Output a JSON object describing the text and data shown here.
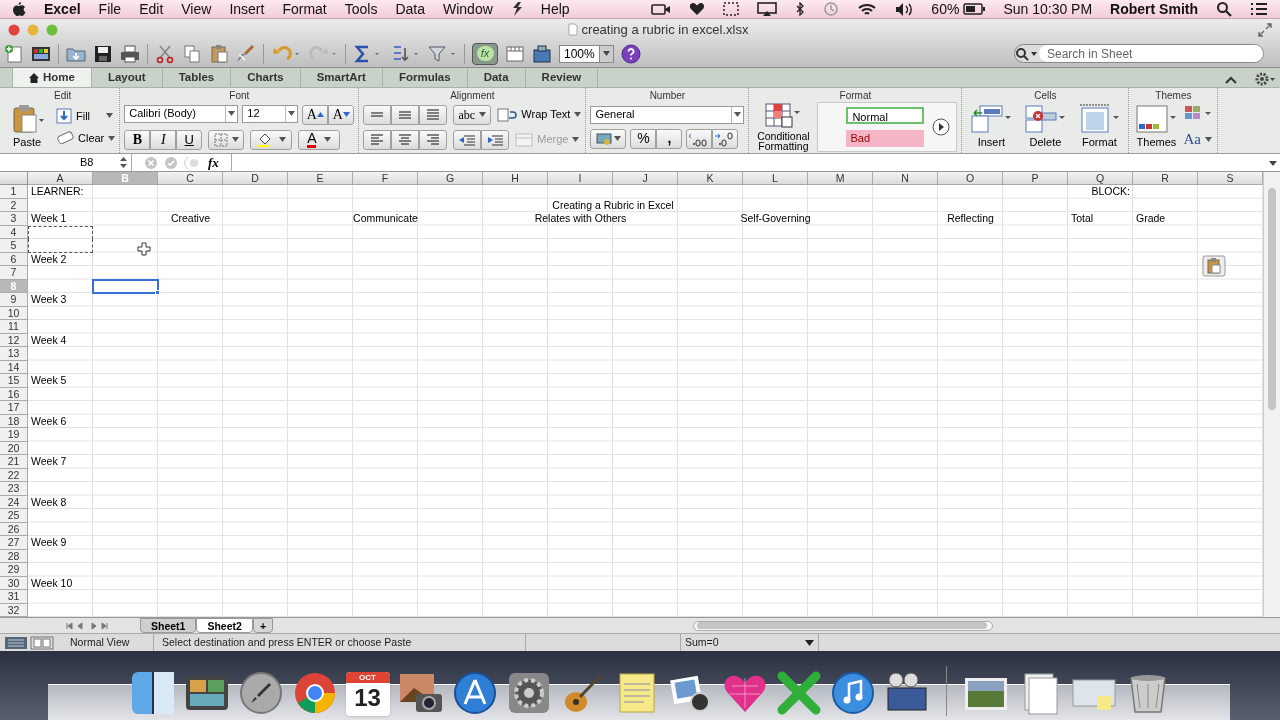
{
  "menu_bar": {
    "app": "Excel",
    "items": [
      "File",
      "Edit",
      "View",
      "Insert",
      "Format",
      "Tools",
      "Data",
      "Window",
      "Help"
    ],
    "battery": "60%",
    "clock": "Sun 10:30 PM",
    "user": "Robert Smith"
  },
  "window": {
    "title": "creating a rubric in excel.xlsx"
  },
  "toolbar": {
    "formula_builder": "fx",
    "zoom": "100%",
    "search": {
      "placeholder": "Search in Sheet"
    }
  },
  "ribbon_tabs": [
    {
      "label": "Home",
      "selected": true
    },
    {
      "label": "Layout",
      "selected": false
    },
    {
      "label": "Tables",
      "selected": false
    },
    {
      "label": "Charts",
      "selected": false
    },
    {
      "label": "SmartArt",
      "selected": false
    },
    {
      "label": "Formulas",
      "selected": false
    },
    {
      "label": "Data",
      "selected": false
    },
    {
      "label": "Review",
      "selected": false
    }
  ],
  "ribbon": {
    "edit": {
      "title": "Edit",
      "paste": "Paste",
      "fill": "Fill",
      "clear": "Clear"
    },
    "font": {
      "title": "Font",
      "family": "Calibri (Body)",
      "size": "12",
      "bold": "B",
      "italic": "I",
      "underline": "U",
      "grow": "A",
      "shrink": "A",
      "font_color_letter": "A"
    },
    "alignment": {
      "title": "Alignment",
      "orientation": "abc",
      "wrap": "Wrap Text",
      "merge": "Merge",
      "merge_disabled": true
    },
    "number": {
      "title": "Number",
      "format": "General",
      "percent": "%",
      "comma": ","
    },
    "format": {
      "title": "Format",
      "conditional": "Conditional Formatting",
      "styles": [
        {
          "label": "Normal",
          "kind": "normal"
        },
        {
          "label": "Bad",
          "kind": "bad"
        }
      ]
    },
    "cells": {
      "title": "Cells",
      "buttons": [
        "Insert",
        "Delete",
        "Format"
      ]
    },
    "themes": {
      "title": "Themes",
      "button": "Themes",
      "fonts": "Aa"
    }
  },
  "formula_bar": {
    "name_box": "B8",
    "fx": "fx"
  },
  "sheet": {
    "columns": [
      {
        "label": "A",
        "selected": false
      },
      {
        "label": "B",
        "selected": true
      },
      {
        "label": "C",
        "selected": false
      },
      {
        "label": "D",
        "selected": false
      },
      {
        "label": "E",
        "selected": false
      },
      {
        "label": "F",
        "selected": false
      },
      {
        "label": "G",
        "selected": false
      },
      {
        "label": "H",
        "selected": false
      },
      {
        "label": "I",
        "selected": false
      },
      {
        "label": "J",
        "selected": false
      },
      {
        "label": "K",
        "selected": false
      },
      {
        "label": "L",
        "selected": false
      },
      {
        "label": "M",
        "selected": false
      },
      {
        "label": "N",
        "selected": false
      },
      {
        "label": "O",
        "selected": false
      },
      {
        "label": "P",
        "selected": false
      },
      {
        "label": "Q",
        "selected": false
      },
      {
        "label": "R",
        "selected": false
      },
      {
        "label": "S",
        "selected": false
      }
    ],
    "rows": [
      {
        "number": "1",
        "selected": false,
        "kind": "info",
        "cells": {
          "A": "LEARNER:",
          "Q": "BLOCK:"
        }
      },
      {
        "number": "2",
        "selected": false,
        "kind": "title",
        "cells": {
          "I": "Creating a Rubric in Excel"
        }
      },
      {
        "number": "3",
        "selected": false,
        "kind": "headings",
        "cells": {
          "A": "Week 1",
          "C": "Creative",
          "F": "Communicate",
          "I": "Relates with Others",
          "L": "Self-Governing",
          "O": "Reflecting",
          "Q": "Total",
          "R": "Grade"
        }
      },
      {
        "number": "4",
        "selected": false,
        "copied": {
          "A": true
        }
      },
      {
        "number": "5",
        "selected": false,
        "copied": {
          "A": true
        }
      },
      {
        "number": "6",
        "selected": false,
        "kind": "plain",
        "cells": {
          "A": "Week 2"
        }
      },
      {
        "number": "7",
        "selected": false
      },
      {
        "number": "8",
        "selected": true
      },
      {
        "number": "9",
        "selected": false,
        "kind": "plain",
        "cells": {
          "A": "Week 3"
        }
      },
      {
        "number": "10",
        "selected": false
      },
      {
        "number": "11",
        "selected": false
      },
      {
        "number": "12",
        "selected": false,
        "kind": "plain",
        "cells": {
          "A": "Week 4"
        }
      },
      {
        "number": "13",
        "selected": false
      },
      {
        "number": "14",
        "selected": false
      },
      {
        "number": "15",
        "selected": false,
        "kind": "plain",
        "cells": {
          "A": "Week 5"
        }
      },
      {
        "number": "16",
        "selected": false
      },
      {
        "number": "17",
        "selected": false
      },
      {
        "number": "18",
        "selected": false,
        "kind": "plain",
        "cells": {
          "A": "Week 6"
        }
      },
      {
        "number": "19",
        "selected": false
      },
      {
        "number": "20",
        "selected": false
      },
      {
        "number": "21",
        "selected": false,
        "kind": "plain",
        "cells": {
          "A": "Week 7"
        }
      },
      {
        "number": "22",
        "selected": false
      },
      {
        "number": "23",
        "selected": false
      },
      {
        "number": "24",
        "selected": false,
        "kind": "plain",
        "cells": {
          "A": "Week 8"
        }
      },
      {
        "number": "25",
        "selected": false
      },
      {
        "number": "26",
        "selected": false
      },
      {
        "number": "27",
        "selected": false,
        "kind": "plain",
        "cells": {
          "A": "Week 9"
        }
      },
      {
        "number": "28",
        "selected": false
      },
      {
        "number": "29",
        "selected": false
      },
      {
        "number": "30",
        "selected": false,
        "kind": "plain",
        "cells": {
          "A": "Week 10"
        }
      },
      {
        "number": "31",
        "selected": false
      },
      {
        "number": "32",
        "selected": false
      }
    ]
  },
  "sheet_tabs": [
    {
      "label": "Sheet1",
      "selected": false
    },
    {
      "label": "Sheet2",
      "selected": true
    }
  ],
  "add_sheet": "+",
  "status_bar": {
    "view": "Normal View",
    "message": "Select destination and press ENTER or choose Paste",
    "sum": "Sum=0"
  },
  "dock": {
    "calendar_month": "OCT",
    "calendar_day": "13"
  }
}
